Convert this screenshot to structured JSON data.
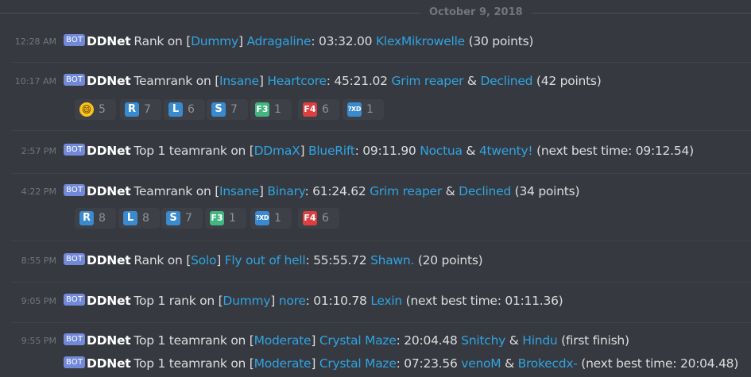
{
  "date_divider": "October 9, 2018",
  "bot_tag": "BOT",
  "username": "DDNet",
  "messages": [
    {
      "time": "12:28 AM",
      "parts": [
        {
          "t": "Rank on [",
          "c": "text"
        },
        {
          "t": "Dummy",
          "c": "link"
        },
        {
          "t": "] ",
          "c": "text"
        },
        {
          "t": "Adragaline",
          "c": "link"
        },
        {
          "t": ": 03:32.00 ",
          "c": "text"
        },
        {
          "t": "KlexMikrowelle",
          "c": "link"
        },
        {
          "t": " (30 points)",
          "c": "text"
        }
      ]
    },
    {
      "time": "10:17 AM",
      "parts": [
        {
          "t": "Teamrank on [",
          "c": "text"
        },
        {
          "t": "Insane",
          "c": "link"
        },
        {
          "t": "] ",
          "c": "text"
        },
        {
          "t": "Heartcore",
          "c": "link"
        },
        {
          "t": ": 45:21.02 ",
          "c": "text"
        },
        {
          "t": "Grim reaper",
          "c": "link"
        },
        {
          "t": " & ",
          "c": "text"
        },
        {
          "t": "Declined",
          "c": "link"
        },
        {
          "t": " (42 points)",
          "c": "text"
        }
      ],
      "reactions": [
        {
          "icon": "grinning-face-icon",
          "label": "😄",
          "count": "5"
        },
        {
          "icon": "regional-indicator-r-icon",
          "label": "R",
          "count": "7"
        },
        {
          "icon": "regional-indicator-l-icon",
          "label": "L",
          "count": "6"
        },
        {
          "icon": "regional-indicator-s-icon",
          "label": "S",
          "count": "7"
        },
        {
          "icon": "f3-emote-icon",
          "label": "F3",
          "count": "1"
        },
        {
          "icon": "f4-emote-icon",
          "label": "F4",
          "count": "6"
        },
        {
          "icon": "xd-emote-icon",
          "label": "?XD",
          "count": "1"
        }
      ]
    },
    {
      "time": "2:57 PM",
      "parts": [
        {
          "t": "Top 1 teamrank on [",
          "c": "text"
        },
        {
          "t": "DDmaX",
          "c": "link"
        },
        {
          "t": "] ",
          "c": "text"
        },
        {
          "t": "BlueRift",
          "c": "link"
        },
        {
          "t": ": 09:11.90 ",
          "c": "text"
        },
        {
          "t": "Noctua",
          "c": "link"
        },
        {
          "t": " & ",
          "c": "text"
        },
        {
          "t": "4twenty!",
          "c": "link"
        },
        {
          "t": " (next best time: 09:12.54)",
          "c": "text"
        }
      ]
    },
    {
      "time": "4:22 PM",
      "parts": [
        {
          "t": "Teamrank on [",
          "c": "text"
        },
        {
          "t": "Insane",
          "c": "link"
        },
        {
          "t": "] ",
          "c": "text"
        },
        {
          "t": "Binary",
          "c": "link"
        },
        {
          "t": ": 61:24.62 ",
          "c": "text"
        },
        {
          "t": "Grim reaper",
          "c": "link"
        },
        {
          "t": " & ",
          "c": "text"
        },
        {
          "t": "Declined",
          "c": "link"
        },
        {
          "t": " (34 points)",
          "c": "text"
        }
      ],
      "reactions": [
        {
          "icon": "regional-indicator-r-icon",
          "label": "R",
          "count": "8"
        },
        {
          "icon": "regional-indicator-l-icon",
          "label": "L",
          "count": "8"
        },
        {
          "icon": "regional-indicator-s-icon",
          "label": "S",
          "count": "7"
        },
        {
          "icon": "f3-emote-icon",
          "label": "F3",
          "count": "1"
        },
        {
          "icon": "xd-emote-icon",
          "label": "?XD",
          "count": "1"
        },
        {
          "icon": "f4-emote-icon",
          "label": "F4",
          "count": "6"
        }
      ]
    },
    {
      "time": "8:55 PM",
      "parts": [
        {
          "t": "Rank on [",
          "c": "text"
        },
        {
          "t": "Solo",
          "c": "link"
        },
        {
          "t": "] ",
          "c": "text"
        },
        {
          "t": "Fly out of hell",
          "c": "link"
        },
        {
          "t": ": 55:55.72 ",
          "c": "text"
        },
        {
          "t": "Shawn.",
          "c": "link"
        },
        {
          "t": " (20 points)",
          "c": "text"
        }
      ]
    },
    {
      "time": "9:05 PM",
      "parts": [
        {
          "t": "Top 1 rank on [",
          "c": "text"
        },
        {
          "t": "Dummy",
          "c": "link"
        },
        {
          "t": "] ",
          "c": "text"
        },
        {
          "t": "nore",
          "c": "link"
        },
        {
          "t": ": 01:10.78 ",
          "c": "text"
        },
        {
          "t": "Lexin",
          "c": "link"
        },
        {
          "t": " (next best time: 01:11.36)",
          "c": "text"
        }
      ]
    },
    {
      "time": "9:55 PM",
      "parts": [
        {
          "t": "Top 1 teamrank on [",
          "c": "text"
        },
        {
          "t": "Moderate",
          "c": "link"
        },
        {
          "t": "] ",
          "c": "text"
        },
        {
          "t": "Crystal Maze",
          "c": "link"
        },
        {
          "t": ": 20:04.48 ",
          "c": "text"
        },
        {
          "t": "Snitchy",
          "c": "link"
        },
        {
          "t": " & ",
          "c": "text"
        },
        {
          "t": "Hindu",
          "c": "link"
        },
        {
          "t": " (first finish)",
          "c": "text"
        }
      ]
    },
    {
      "time": "",
      "parts": [
        {
          "t": "Top 1 teamrank on [",
          "c": "text"
        },
        {
          "t": "Moderate",
          "c": "link"
        },
        {
          "t": "] ",
          "c": "text"
        },
        {
          "t": "Crystal Maze",
          "c": "link"
        },
        {
          "t": ": 07:23.56 ",
          "c": "text"
        },
        {
          "t": "venoM",
          "c": "link"
        },
        {
          "t": " & ",
          "c": "text"
        },
        {
          "t": "Brokecdx-",
          "c": "link"
        },
        {
          "t": " (next best time: 20:04.48)",
          "c": "text"
        }
      ]
    }
  ]
}
